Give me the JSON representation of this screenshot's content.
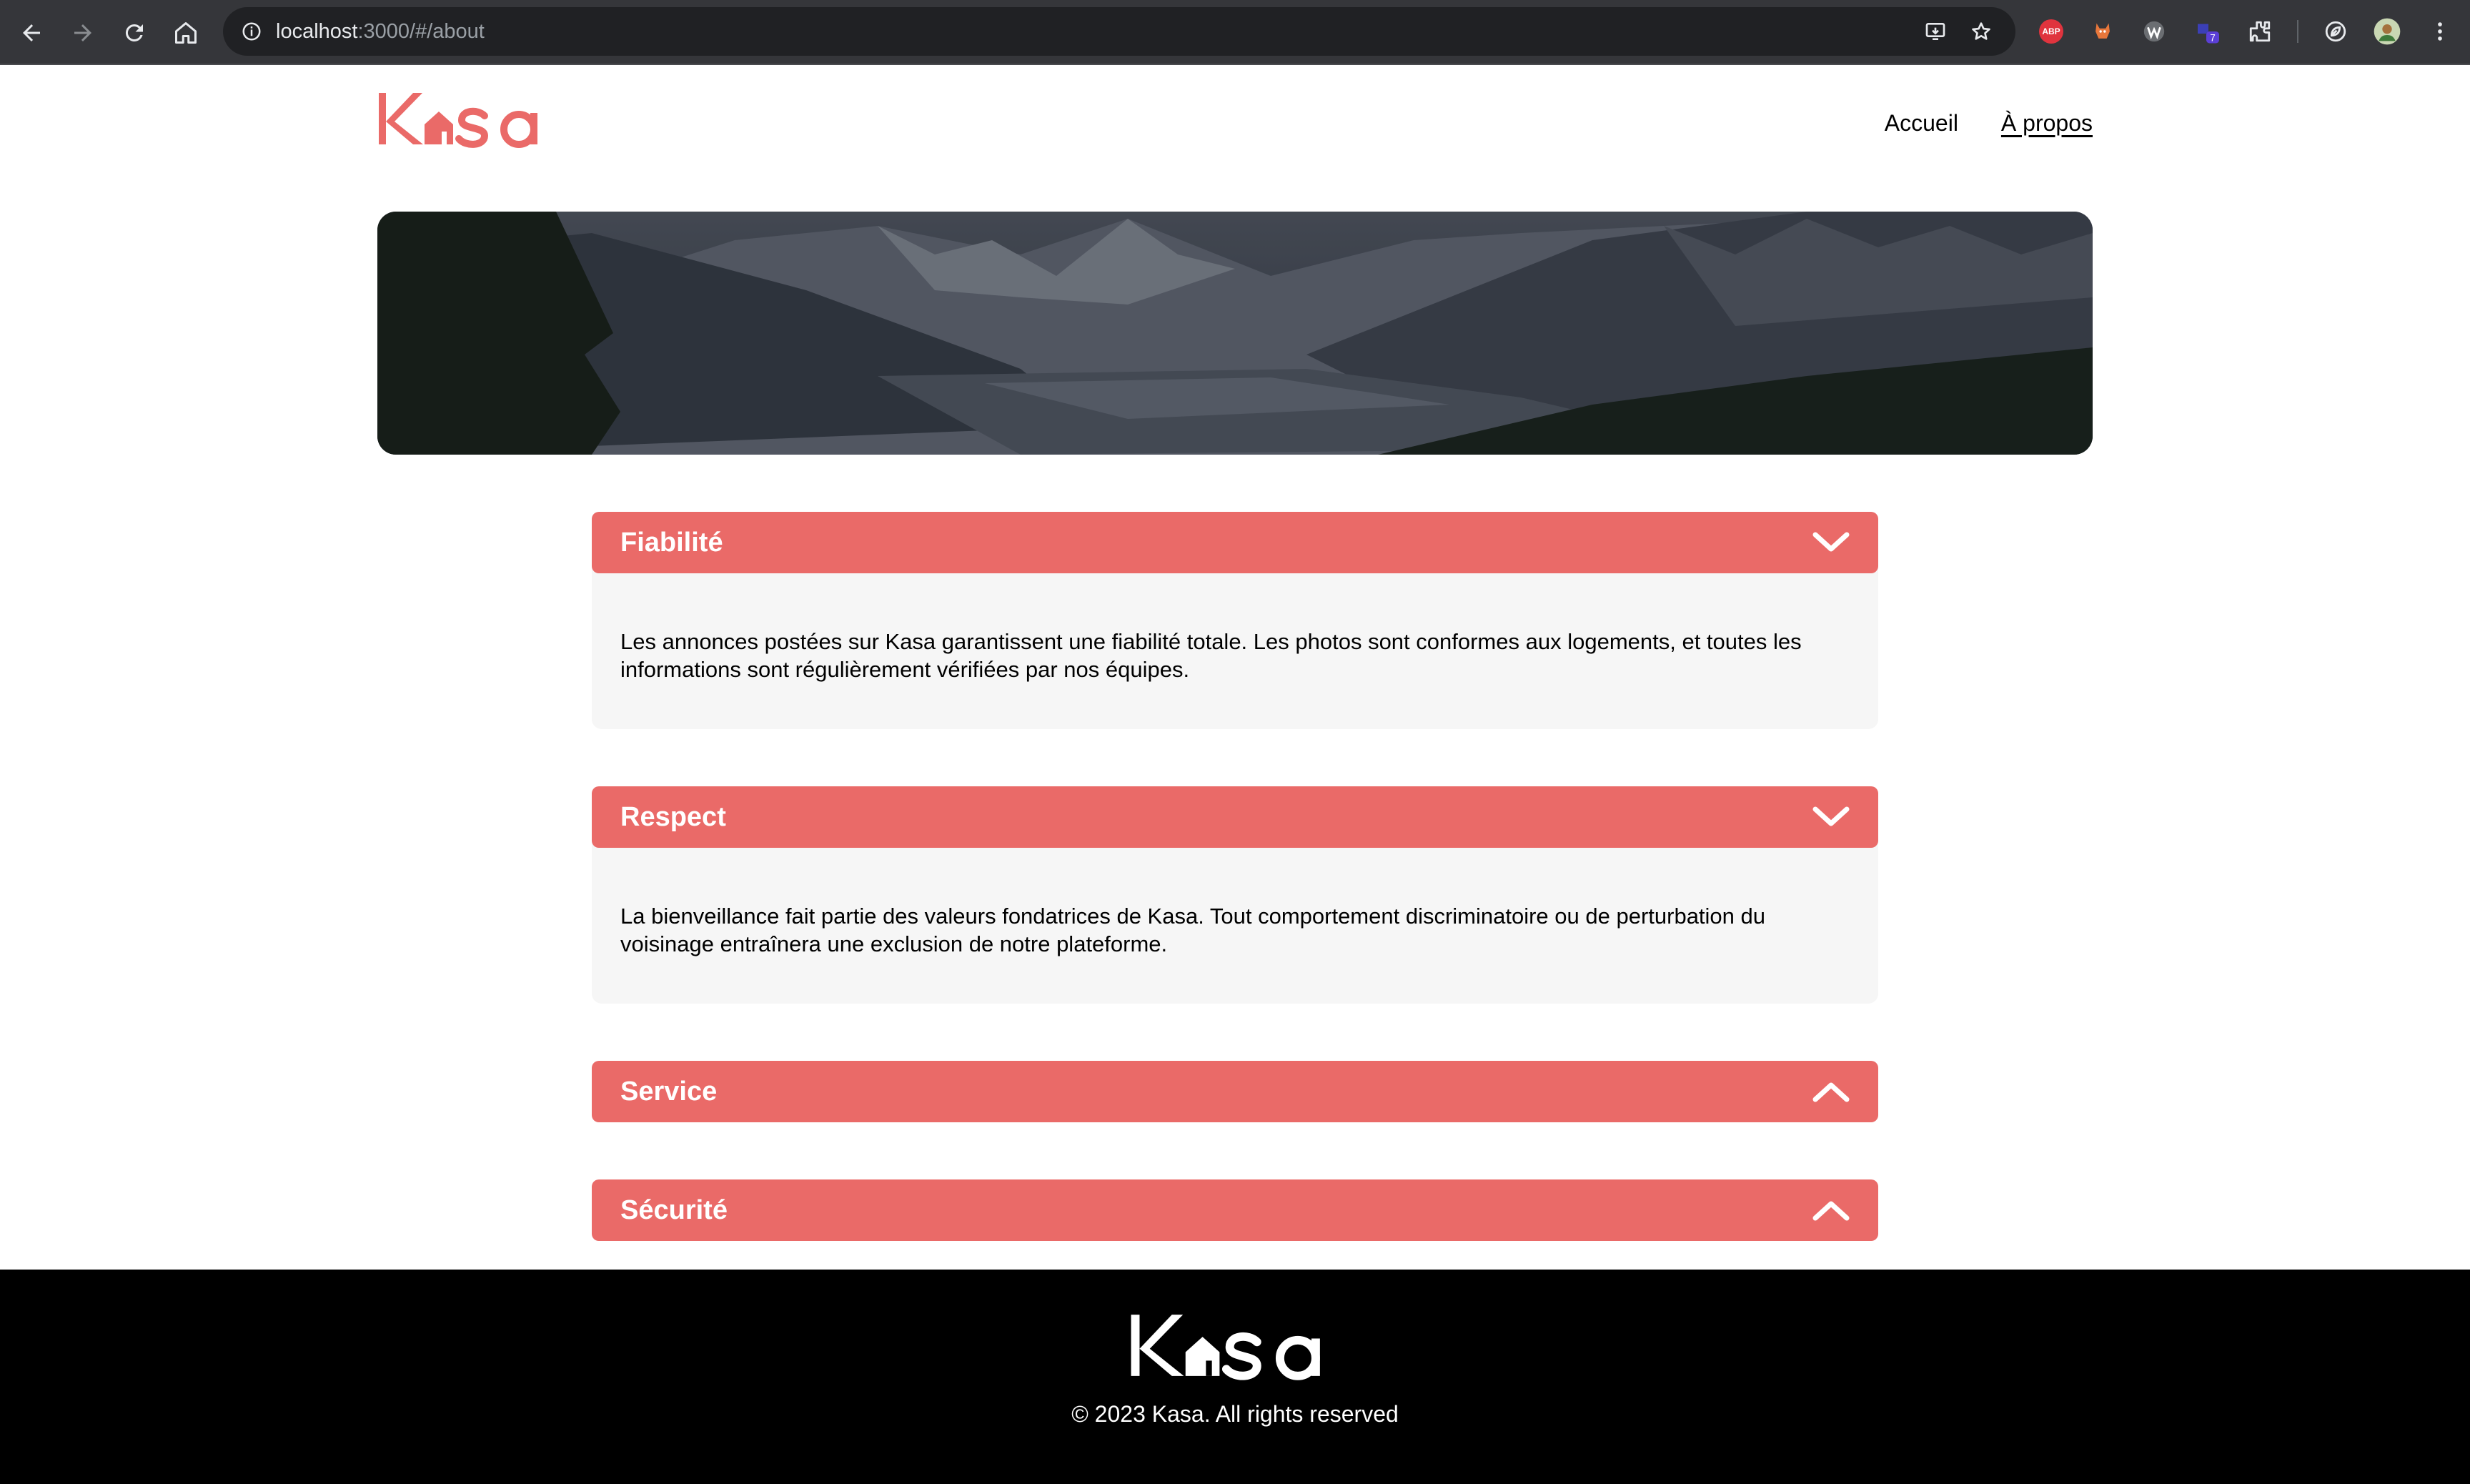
{
  "browser": {
    "url_host": "localhost",
    "url_path": ":3000/#/about",
    "extensions": [
      {
        "name": "adblock-plus",
        "label": "ABP"
      },
      {
        "name": "fox-extension"
      },
      {
        "name": "wappalyzer"
      },
      {
        "name": "extension-badge",
        "badge": "7"
      }
    ]
  },
  "header": {
    "logo": "Kasa",
    "nav": [
      {
        "label": "Accueil"
      },
      {
        "label": "À propos"
      }
    ]
  },
  "collapses": [
    {
      "title": "Fiabilité",
      "expanded": true,
      "text": "Les annonces postées sur Kasa garantissent une fiabilité totale. Les photos sont conformes aux logements, et toutes les informations sont régulièrement vérifiées par nos équipes."
    },
    {
      "title": "Respect",
      "expanded": true,
      "text": "La bienveillance fait partie des valeurs fondatrices de Kasa. Tout comportement discriminatoire ou de perturbation du voisinage entraînera une exclusion de notre plateforme."
    },
    {
      "title": "Service",
      "expanded": false
    },
    {
      "title": "Sécurité",
      "expanded": false
    }
  ],
  "footer": {
    "logo": "Kasa",
    "copyright": "© 2023 Kasa. All rights reserved"
  },
  "colors": {
    "accent": "#ea6a68",
    "chrome": "#35363a",
    "footer": "#000000",
    "collapse_body": "#f6f6f6"
  }
}
